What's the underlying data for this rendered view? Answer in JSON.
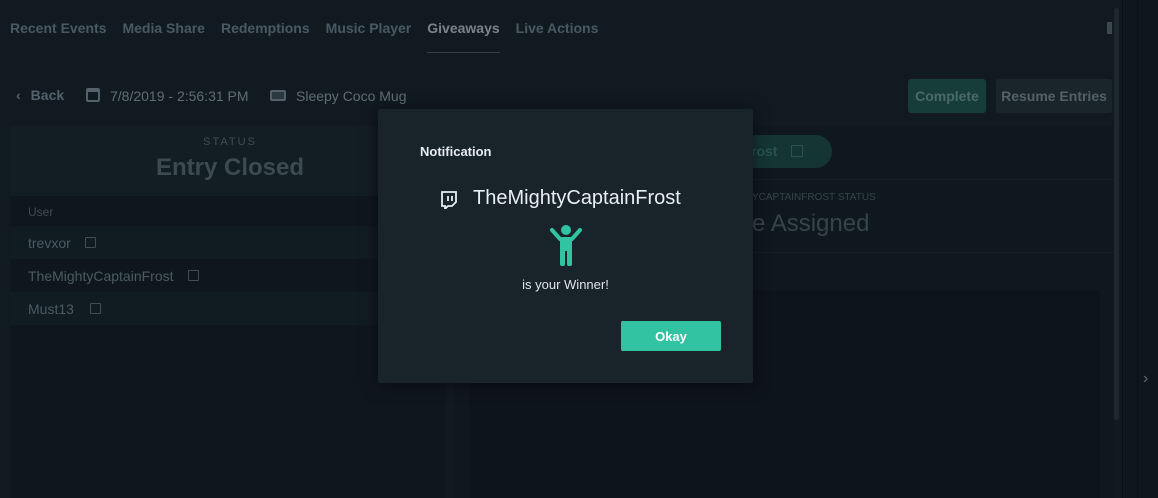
{
  "tabs": [
    {
      "label": "Recent Events",
      "active": false
    },
    {
      "label": "Media Share",
      "active": false
    },
    {
      "label": "Redemptions",
      "active": false
    },
    {
      "label": "Music Player",
      "active": false
    },
    {
      "label": "Giveaways",
      "active": true
    },
    {
      "label": "Live Actions",
      "active": false
    }
  ],
  "infobar": {
    "back_label": "Back",
    "date": "7/8/2019 - 2:56:31 PM",
    "prize": "Sleepy Coco Mug",
    "complete_label": "Complete",
    "resume_label": "Resume Entries"
  },
  "left": {
    "status_label": "STATUS",
    "status_value": "Entry Closed",
    "user_header": "User",
    "users": [
      "trevxor",
      "TheMightyCaptainFrost",
      "Must13"
    ]
  },
  "right": {
    "pill_text": "rost",
    "status_caption": "YCAPTAINFROST STATUS",
    "assigned_text": "e Assigned"
  },
  "modal": {
    "title": "Notification",
    "winner": "TheMightyCaptainFrost",
    "subtitle": "is your Winner!",
    "okay_label": "Okay"
  },
  "colors": {
    "accent": "#31c3a2",
    "background": "#17242c",
    "modal": "#18232a"
  }
}
